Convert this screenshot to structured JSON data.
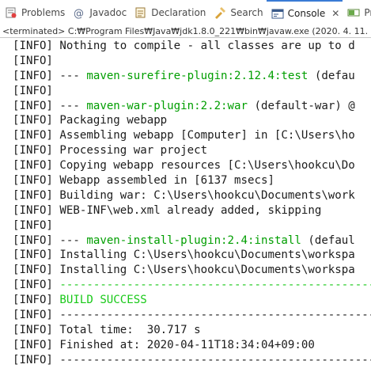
{
  "tabs": [
    {
      "label": "Problems",
      "icon": "problems-icon"
    },
    {
      "label": "Javadoc",
      "icon": "javadoc-icon"
    },
    {
      "label": "Declaration",
      "icon": "declaration-icon"
    },
    {
      "label": "Search",
      "icon": "search-icon"
    },
    {
      "label": "Console",
      "icon": "console-icon",
      "active": true,
      "close": "✕"
    },
    {
      "label": "Progre",
      "icon": "progress-icon"
    }
  ],
  "status_line": "<terminated> C:₩Program Files₩Java₩jdk1.8.0_221₩bin₩javaw.exe (2020. 4. 11. 오",
  "colors": {
    "accent": "#3a7bd5",
    "plugin_text": "#009e00",
    "success_text": "#19c919",
    "console_text": "#1c1c1c"
  },
  "console": {
    "lines": [
      {
        "prefix": "[INFO] ",
        "text": "Nothing to compile - all classes are up to d"
      },
      {
        "prefix": "[INFO] ",
        "text": ""
      },
      {
        "prefix": "[INFO] ",
        "text": "--- ",
        "plugin": "maven-surefire-plugin:2.12.4:test",
        "suffix": " (defau"
      },
      {
        "prefix": "[INFO] ",
        "text": ""
      },
      {
        "prefix": "[INFO] ",
        "text": "--- ",
        "plugin": "maven-war-plugin:2.2:war",
        "suffix": " (default-war) @"
      },
      {
        "prefix": "[INFO] ",
        "text": "Packaging webapp"
      },
      {
        "prefix": "[INFO] ",
        "text": "Assembling webapp [Computer] in [C:\\Users\\ho"
      },
      {
        "prefix": "[INFO] ",
        "text": "Processing war project"
      },
      {
        "prefix": "[INFO] ",
        "text": "Copying webapp resources [C:\\Users\\hookcu\\Do"
      },
      {
        "prefix": "[INFO] ",
        "text": "Webapp assembled in [6137 msecs]"
      },
      {
        "prefix": "[INFO] ",
        "text": "Building war: C:\\Users\\hookcu\\Documents\\work"
      },
      {
        "prefix": "[INFO] ",
        "text": "WEB-INF\\web.xml already added, skipping"
      },
      {
        "prefix": "[INFO] ",
        "text": ""
      },
      {
        "prefix": "[INFO] ",
        "text": "--- ",
        "plugin": "maven-install-plugin:2.4:install",
        "suffix": " (defaul"
      },
      {
        "prefix": "[INFO] ",
        "text": "Installing C:\\Users\\hookcu\\Documents\\workspa"
      },
      {
        "prefix": "[INFO] ",
        "text": "Installing C:\\Users\\hookcu\\Documents\\workspa"
      },
      {
        "prefix": "[INFO] ",
        "dashes": "----------------------------------------------------"
      },
      {
        "prefix": "[INFO] ",
        "success": "BUILD SUCCESS"
      },
      {
        "prefix": "[INFO] ",
        "text": "----------------------------------------------------"
      },
      {
        "prefix": "[INFO] ",
        "text": "Total time:  30.717 s"
      },
      {
        "prefix": "[INFO] ",
        "text": "Finished at: 2020-04-11T18:34:04+09:00"
      },
      {
        "prefix": "[INFO] ",
        "text": "----------------------------------------------------"
      }
    ]
  }
}
